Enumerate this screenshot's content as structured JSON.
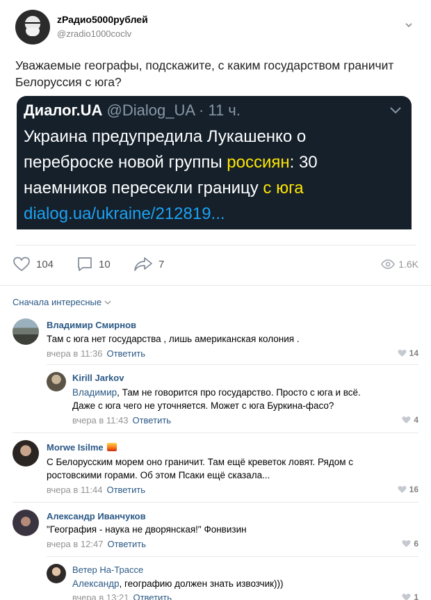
{
  "post": {
    "author_name": "zРадио5000рублей",
    "author_handle": "@zradio1000coclv",
    "text": "Уважаемые географы, подскажите, с каким государством граничит Белоруссия с юга?"
  },
  "embed": {
    "source": "Диалог.UA",
    "handle_time": " @Dialog_UA · 11 ч.",
    "line1": "Украина предупредила Лукашенко о",
    "line2_a": "переброске новой группы ",
    "line2_hl": "россиян",
    "line2_b": ": 30",
    "line3_a": "наемников пересекли границу ",
    "line3_hl": "с юга",
    "line4": "dialog.ua/ukraine/212819..."
  },
  "actions": {
    "likes": "104",
    "comments": "10",
    "shares": "7",
    "views": "1.6K"
  },
  "sort_label": "Сначала интересные",
  "comments": [
    {
      "name": "Владимир Смирнов",
      "text": "Там с юга нет государства , лишь американская колония .",
      "time": "вчера в 11:36",
      "reply": "Ответить",
      "likes": "14"
    },
    {
      "name": "Kirill Jarkov",
      "mention": "Владимир",
      "text_line1": ", Там не говорится про государство. Просто с юга и всё.",
      "text_line2": "Даже с юга чего не уточняется. Может с юга Буркина-фасо?",
      "time": "вчера в 11:43",
      "reply": "Ответить",
      "likes": "4"
    },
    {
      "name": "Morwe Isilme",
      "text_line1": "С Белорусским морем оно граничит. Там ещё креветок ловят. Рядом с",
      "text_line2": "ростовскими горами. Об этом Псаки ещё сказала...",
      "time": "вчера в 11:44",
      "reply": "Ответить",
      "likes": "16"
    },
    {
      "name": "Александр Иванчуков",
      "text": "\"География - наука не дворянская!\" Фонвизин",
      "time": "вчера в 12:47",
      "reply": "Ответить",
      "likes": "6"
    },
    {
      "name": "Ветер На-Трассе",
      "mention": "Александр",
      "text": ", географию должен знать извозчик)))",
      "time": "вчера в 13:21",
      "reply": "Ответить",
      "likes": "1"
    }
  ],
  "colors": {
    "link": "#2a5885",
    "embed_bg": "#15202b",
    "highlight": "#ffe600",
    "twitter_blue": "#1da1f2"
  }
}
